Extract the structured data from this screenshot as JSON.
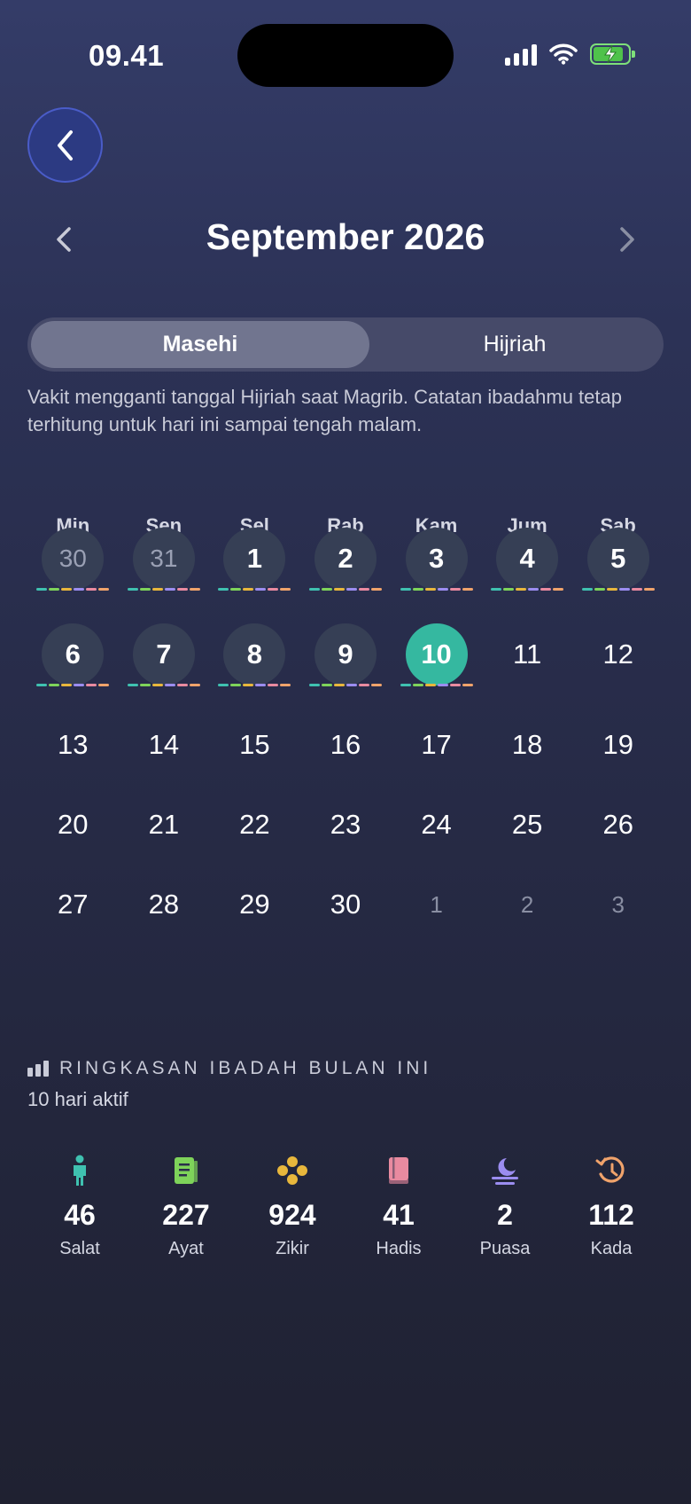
{
  "status": {
    "time": "09.41"
  },
  "header": {
    "month_title": "September 2026"
  },
  "tabs": [
    {
      "label": "Masehi",
      "active": true
    },
    {
      "label": "Hijriah",
      "active": false
    }
  ],
  "note": "Vakit mengganti tanggal Hijriah saat Magrib. Catatan ibadahmu tetap terhitung untuk hari ini sampai tengah malam.",
  "weekdays": [
    "Min",
    "Sen",
    "Sel",
    "Rab",
    "Kam",
    "Jum",
    "Sab"
  ],
  "weeks": [
    [
      "30",
      "31",
      "1",
      "2",
      "3",
      "4",
      "5"
    ],
    [
      "6",
      "7",
      "8",
      "9",
      "10",
      "11",
      "12"
    ],
    [
      "13",
      "14",
      "15",
      "16",
      "17",
      "18",
      "19"
    ],
    [
      "20",
      "21",
      "22",
      "23",
      "24",
      "25",
      "26"
    ],
    [
      "27",
      "28",
      "29",
      "30",
      "1",
      "2",
      "3"
    ]
  ],
  "selected_date": "10",
  "activity_colors": [
    "#3fc1b0",
    "#7ed35a",
    "#e8b73c",
    "#9b8df0",
    "#e98aa0",
    "#f0a36b"
  ],
  "summary": {
    "title": "RINGKASAN IBADAH BULAN INI",
    "subtitle": "10 hari aktif",
    "stats": [
      {
        "icon": "person-standing-icon",
        "color": "#3fc1b0",
        "value": "46",
        "label": "Salat"
      },
      {
        "icon": "book-page-icon",
        "color": "#7ed35a",
        "value": "227",
        "label": "Ayat"
      },
      {
        "icon": "beads-icon",
        "color": "#e8b73c",
        "value": "924",
        "label": "Zikir"
      },
      {
        "icon": "book-icon",
        "color": "#e98aa0",
        "value": "41",
        "label": "Hadis"
      },
      {
        "icon": "moon-icon",
        "color": "#9b8df0",
        "value": "2",
        "label": "Puasa"
      },
      {
        "icon": "history-icon",
        "color": "#f0a36b",
        "value": "112",
        "label": "Kada"
      }
    ]
  }
}
